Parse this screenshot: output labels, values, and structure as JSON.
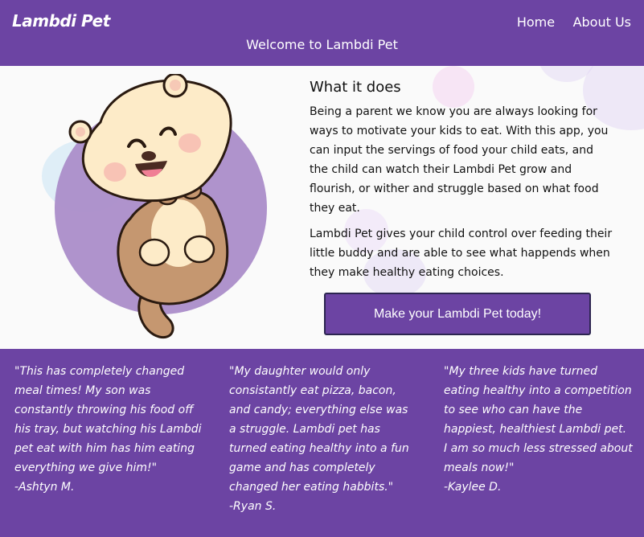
{
  "header": {
    "logo": "Lambdi Pet",
    "nav": [
      "Home",
      "About Us"
    ],
    "welcome": "Welcome to Lambdi Pet"
  },
  "main": {
    "heading": "What it does",
    "paragraphs": [
      "Being a parent we know you are always looking for ways to motivate your kids to eat. With this app, you can input the servings of food your child eats, and the child can watch their Lambdi Pet grow and flourish, or wither and struggle based on what food they eat.",
      "Lambdi Pet gives your child control over feeding their little buddy and are able to see what happends when they make healthy eating choices."
    ],
    "cta": "Make your Lambdi Pet today!"
  },
  "testimonials": [
    {
      "quote": "\"This has completely changed meal times! My son was constantly throwing his food off his tray, but watching his Lambdi pet eat with him has him eating everything we give him!\"",
      "author": "-Ashtyn M."
    },
    {
      "quote": "\"My daughter would only consistantly eat pizza, bacon, and candy; everything else was a struggle. Lambdi pet has turned eating healthy into a fun game and has completely changed her eating habbits.\"",
      "author": "-Ryan S."
    },
    {
      "quote": "\"My three kids have turned eating healthy into a competition to see who can have the happiest, healthiest Lambdi pet. I am so much less stressed about meals now!\"",
      "author": "-Kaylee D."
    }
  ],
  "colors": {
    "brand": "#6c44a3",
    "pet_circle": "#ab8dc9",
    "otter_head": "#fdebc8",
    "otter_body": "#c59770"
  },
  "icons": [
    "otter-mascot-illustration"
  ]
}
